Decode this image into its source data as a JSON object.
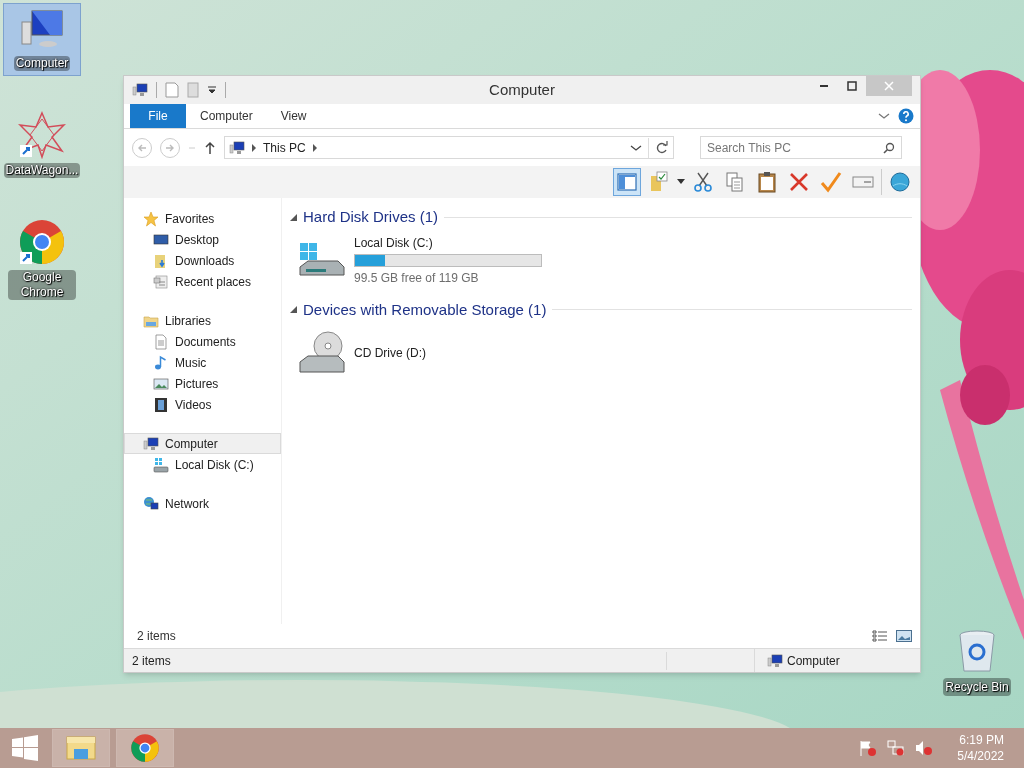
{
  "desktop_icons": [
    {
      "label": "Computer",
      "kind": "computer",
      "selected": true
    },
    {
      "label": "DataWagon...",
      "kind": "datawagon",
      "selected": false
    },
    {
      "label": "Google Chrome",
      "kind": "chrome",
      "selected": false
    }
  ],
  "recycle_bin": {
    "label": "Recycle Bin"
  },
  "window": {
    "title": "Computer",
    "ribbon_tabs": [
      {
        "label": "File",
        "kind": "file"
      },
      {
        "label": "Computer",
        "kind": "tab"
      },
      {
        "label": "View",
        "kind": "tab"
      }
    ],
    "address": {
      "crumbs": [
        "This PC"
      ]
    },
    "search": {
      "placeholder": "Search This PC"
    },
    "toolbar": [
      {
        "kind": "preview",
        "on": true
      },
      {
        "kind": "folder",
        "on": false
      },
      {
        "kind": "cut",
        "on": false
      },
      {
        "kind": "copy",
        "on": false
      },
      {
        "kind": "paste",
        "on": false
      },
      {
        "kind": "delete",
        "on": false
      },
      {
        "kind": "check",
        "on": false
      },
      {
        "kind": "rename",
        "on": false
      },
      {
        "kind": "shell",
        "on": false
      }
    ],
    "nav": [
      {
        "label": "Favorites",
        "kind": "star",
        "selected": false,
        "children": [
          {
            "label": "Desktop",
            "kind": "desktop"
          },
          {
            "label": "Downloads",
            "kind": "downloads"
          },
          {
            "label": "Recent places",
            "kind": "recent"
          }
        ]
      },
      {
        "label": "Libraries",
        "kind": "libraries",
        "selected": false,
        "children": [
          {
            "label": "Documents",
            "kind": "documents"
          },
          {
            "label": "Music",
            "kind": "music"
          },
          {
            "label": "Pictures",
            "kind": "pictures"
          },
          {
            "label": "Videos",
            "kind": "videos"
          }
        ]
      },
      {
        "label": "Computer",
        "kind": "computer",
        "selected": true,
        "children": [
          {
            "label": "Local Disk (C:)",
            "kind": "disk"
          }
        ]
      },
      {
        "label": "Network",
        "kind": "network",
        "selected": false
      }
    ],
    "groups": [
      {
        "title": "Hard Disk Drives (1)",
        "items": [
          {
            "name": "Local Disk (C:)",
            "kind": "disk",
            "level": 0.16,
            "reading": "99.5 GB free of 119 GB"
          }
        ]
      },
      {
        "title": "Devices with Removable Storage (1)",
        "items": [
          {
            "name": "CD Drive (D:)",
            "kind": "cd"
          }
        ]
      }
    ],
    "item_count": "2 items",
    "status_bar": {
      "count": "2 items",
      "location": "Computer"
    }
  },
  "taskbar": {
    "buttons": [
      {
        "kind": "start"
      },
      {
        "kind": "explorer"
      },
      {
        "kind": "chrome"
      }
    ],
    "tray": [
      {
        "kind": "flag"
      },
      {
        "kind": "network"
      },
      {
        "kind": "volume"
      }
    ],
    "time": "6:19 PM",
    "date": "5/4/2022"
  }
}
